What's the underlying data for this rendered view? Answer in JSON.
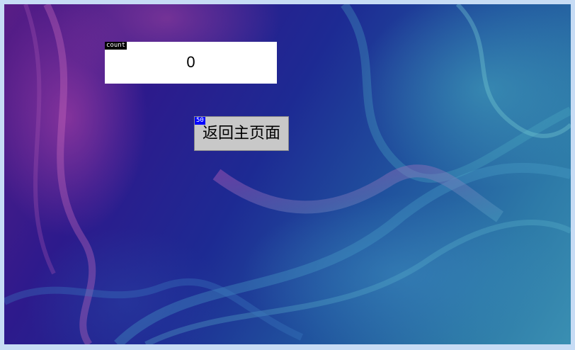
{
  "counter": {
    "tag": "count",
    "value": "0"
  },
  "back_button": {
    "tag": "50",
    "label": "返回主页面"
  },
  "colors": {
    "frame": "#c7dcf5",
    "button_face": "#c8c8c8",
    "tag_count_bg": "#000000",
    "tag_button_bg": "#0000ff"
  },
  "background": {
    "icon": "abstract-wave-wallpaper"
  }
}
